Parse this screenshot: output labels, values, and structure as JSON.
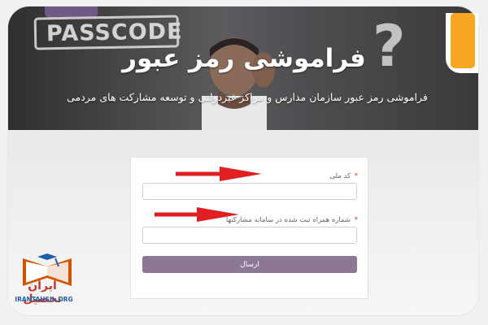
{
  "hero": {
    "background_text": "PASSCODE",
    "question_glyph": "?",
    "title": "فراموشی رمز عبور",
    "subtitle": "فراموشی رمز عبور سازمان مدارس و مراکز غیردولتی و توسعه مشارکت های مردمی"
  },
  "form": {
    "national_code": {
      "label": "کد ملی",
      "required_mark": "*",
      "value": "",
      "placeholder": ""
    },
    "mobile": {
      "label": "شماره همراه ثبت شده در سامانه مشارکتها",
      "required_mark": "*",
      "value": "",
      "placeholder": ""
    },
    "submit_label": "ارسال"
  },
  "watermark": {
    "name": "ایران تحصیل",
    "url": "IRANTAHSIL.ORG"
  },
  "colors": {
    "accent": "#8c7896",
    "arrow": "#e02020",
    "badge": "#f6a623",
    "logo_red": "#c0392b",
    "logo_blue": "#1f5fa8"
  }
}
